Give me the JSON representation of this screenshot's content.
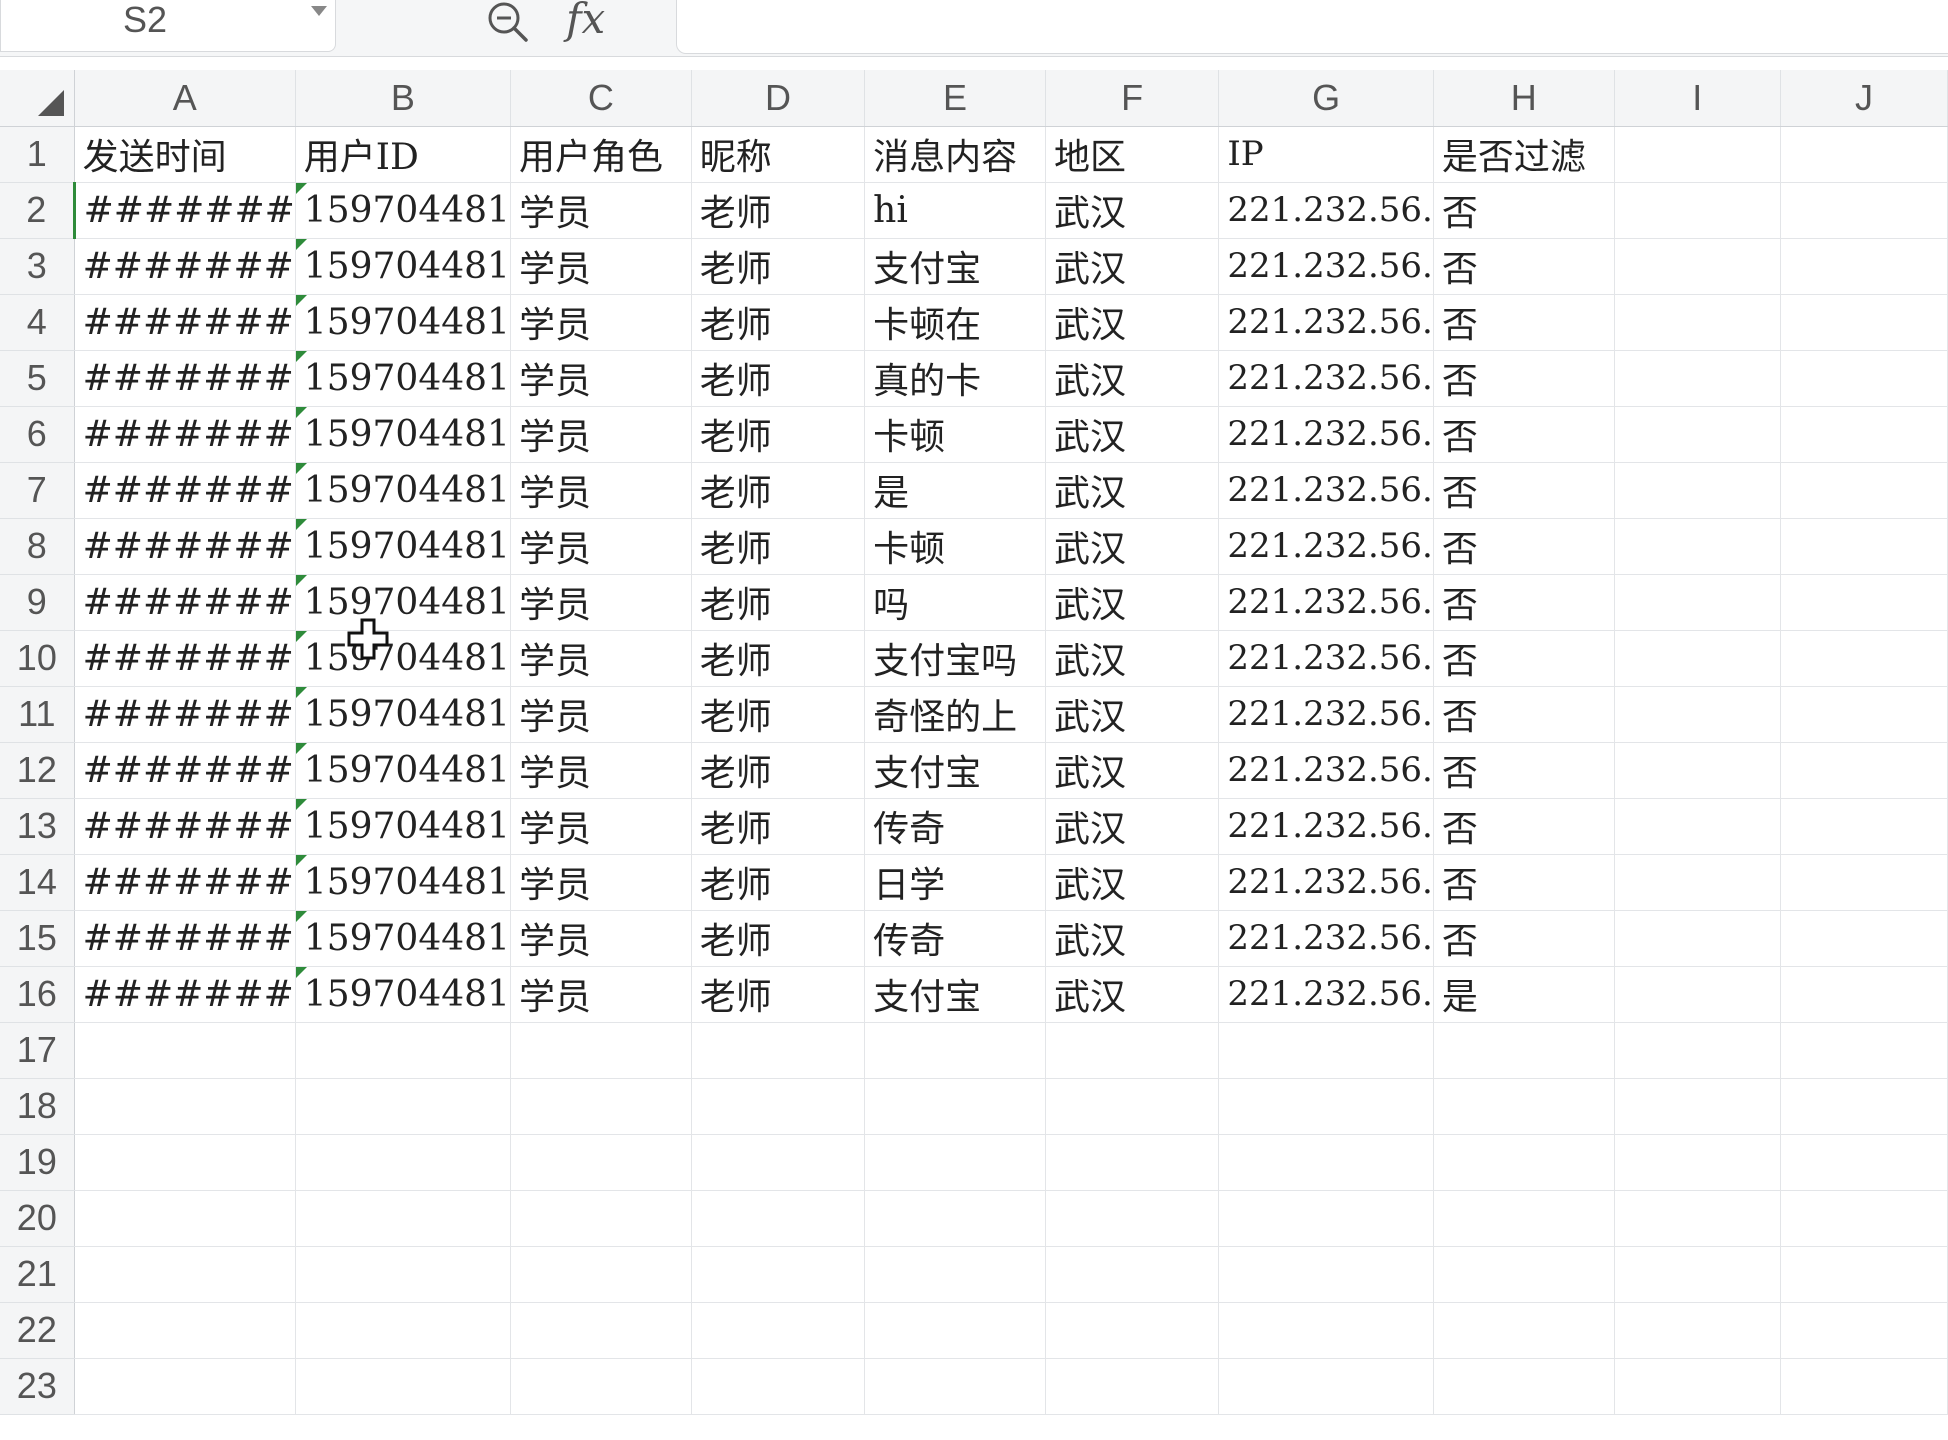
{
  "formula_bar": {
    "name_box": "S2",
    "zoom_icon": "zoom-icon",
    "fx_label": "fx"
  },
  "columns": [
    "A",
    "B",
    "C",
    "D",
    "E",
    "F",
    "G",
    "H",
    "I",
    "J"
  ],
  "rows": [
    {
      "num": "1",
      "cells": [
        "发送时间",
        "用户ID",
        "用户角色",
        "昵称",
        "消息内容",
        "地区",
        "IP",
        "是否过滤",
        "",
        ""
      ]
    },
    {
      "num": "2",
      "cells": [
        "#######",
        "159704481",
        "学员",
        "老师",
        "hi",
        "武汉",
        "221.232.56.",
        "否",
        "",
        ""
      ]
    },
    {
      "num": "3",
      "cells": [
        "#######",
        "159704481",
        "学员",
        "老师",
        "支付宝",
        "武汉",
        "221.232.56.",
        "否",
        "",
        ""
      ]
    },
    {
      "num": "4",
      "cells": [
        "#######",
        "159704481",
        "学员",
        "老师",
        "卡顿在",
        "武汉",
        "221.232.56.",
        "否",
        "",
        ""
      ]
    },
    {
      "num": "5",
      "cells": [
        "#######",
        "159704481",
        "学员",
        "老师",
        "真的卡",
        "武汉",
        "221.232.56.",
        "否",
        "",
        ""
      ]
    },
    {
      "num": "6",
      "cells": [
        "#######",
        "159704481",
        "学员",
        "老师",
        "卡顿",
        "武汉",
        "221.232.56.",
        "否",
        "",
        ""
      ]
    },
    {
      "num": "7",
      "cells": [
        "#######",
        "159704481",
        "学员",
        "老师",
        "是",
        "武汉",
        "221.232.56.",
        "否",
        "",
        ""
      ]
    },
    {
      "num": "8",
      "cells": [
        "#######",
        "159704481",
        "学员",
        "老师",
        "卡顿",
        "武汉",
        "221.232.56.",
        "否",
        "",
        ""
      ]
    },
    {
      "num": "9",
      "cells": [
        "#######",
        "159704481",
        "学员",
        "老师",
        "吗",
        "武汉",
        "221.232.56.",
        "否",
        "",
        ""
      ]
    },
    {
      "num": "10",
      "cells": [
        "#######",
        "159704481",
        "学员",
        "老师",
        "支付宝吗",
        "武汉",
        "221.232.56.",
        "否",
        "",
        ""
      ]
    },
    {
      "num": "11",
      "cells": [
        "#######",
        "159704481",
        "学员",
        "老师",
        "奇怪的上",
        "武汉",
        "221.232.56.",
        "否",
        "",
        ""
      ]
    },
    {
      "num": "12",
      "cells": [
        "#######",
        "159704481",
        "学员",
        "老师",
        "支付宝",
        "武汉",
        "221.232.56.",
        "否",
        "",
        ""
      ]
    },
    {
      "num": "13",
      "cells": [
        "#######",
        "159704481",
        "学员",
        "老师",
        "传奇",
        "武汉",
        "221.232.56.",
        "否",
        "",
        ""
      ]
    },
    {
      "num": "14",
      "cells": [
        "#######",
        "159704481",
        "学员",
        "老师",
        "日学",
        "武汉",
        "221.232.56.",
        "否",
        "",
        ""
      ]
    },
    {
      "num": "15",
      "cells": [
        "#######",
        "159704481",
        "学员",
        "老师",
        "传奇",
        "武汉",
        "221.232.56.",
        "否",
        "",
        ""
      ]
    },
    {
      "num": "16",
      "cells": [
        "#######",
        "159704481",
        "学员",
        "老师",
        "支付宝",
        "武汉",
        "221.232.56.",
        "是",
        "",
        ""
      ]
    },
    {
      "num": "17",
      "cells": [
        "",
        "",
        "",
        "",
        "",
        "",
        "",
        "",
        "",
        ""
      ]
    },
    {
      "num": "18",
      "cells": [
        "",
        "",
        "",
        "",
        "",
        "",
        "",
        "",
        "",
        ""
      ]
    },
    {
      "num": "19",
      "cells": [
        "",
        "",
        "",
        "",
        "",
        "",
        "",
        "",
        "",
        ""
      ]
    },
    {
      "num": "20",
      "cells": [
        "",
        "",
        "",
        "",
        "",
        "",
        "",
        "",
        "",
        ""
      ]
    },
    {
      "num": "21",
      "cells": [
        "",
        "",
        "",
        "",
        "",
        "",
        "",
        "",
        "",
        ""
      ]
    },
    {
      "num": "22",
      "cells": [
        "",
        "",
        "",
        "",
        "",
        "",
        "",
        "",
        "",
        ""
      ]
    },
    {
      "num": "23",
      "cells": [
        "",
        "",
        "",
        "",
        "",
        "",
        "",
        "",
        "",
        ""
      ]
    }
  ],
  "colors": {
    "header_bg": "#f4f5f6",
    "grid_line": "#e3e5e8",
    "triangle_marker": "#2e8b3a"
  }
}
